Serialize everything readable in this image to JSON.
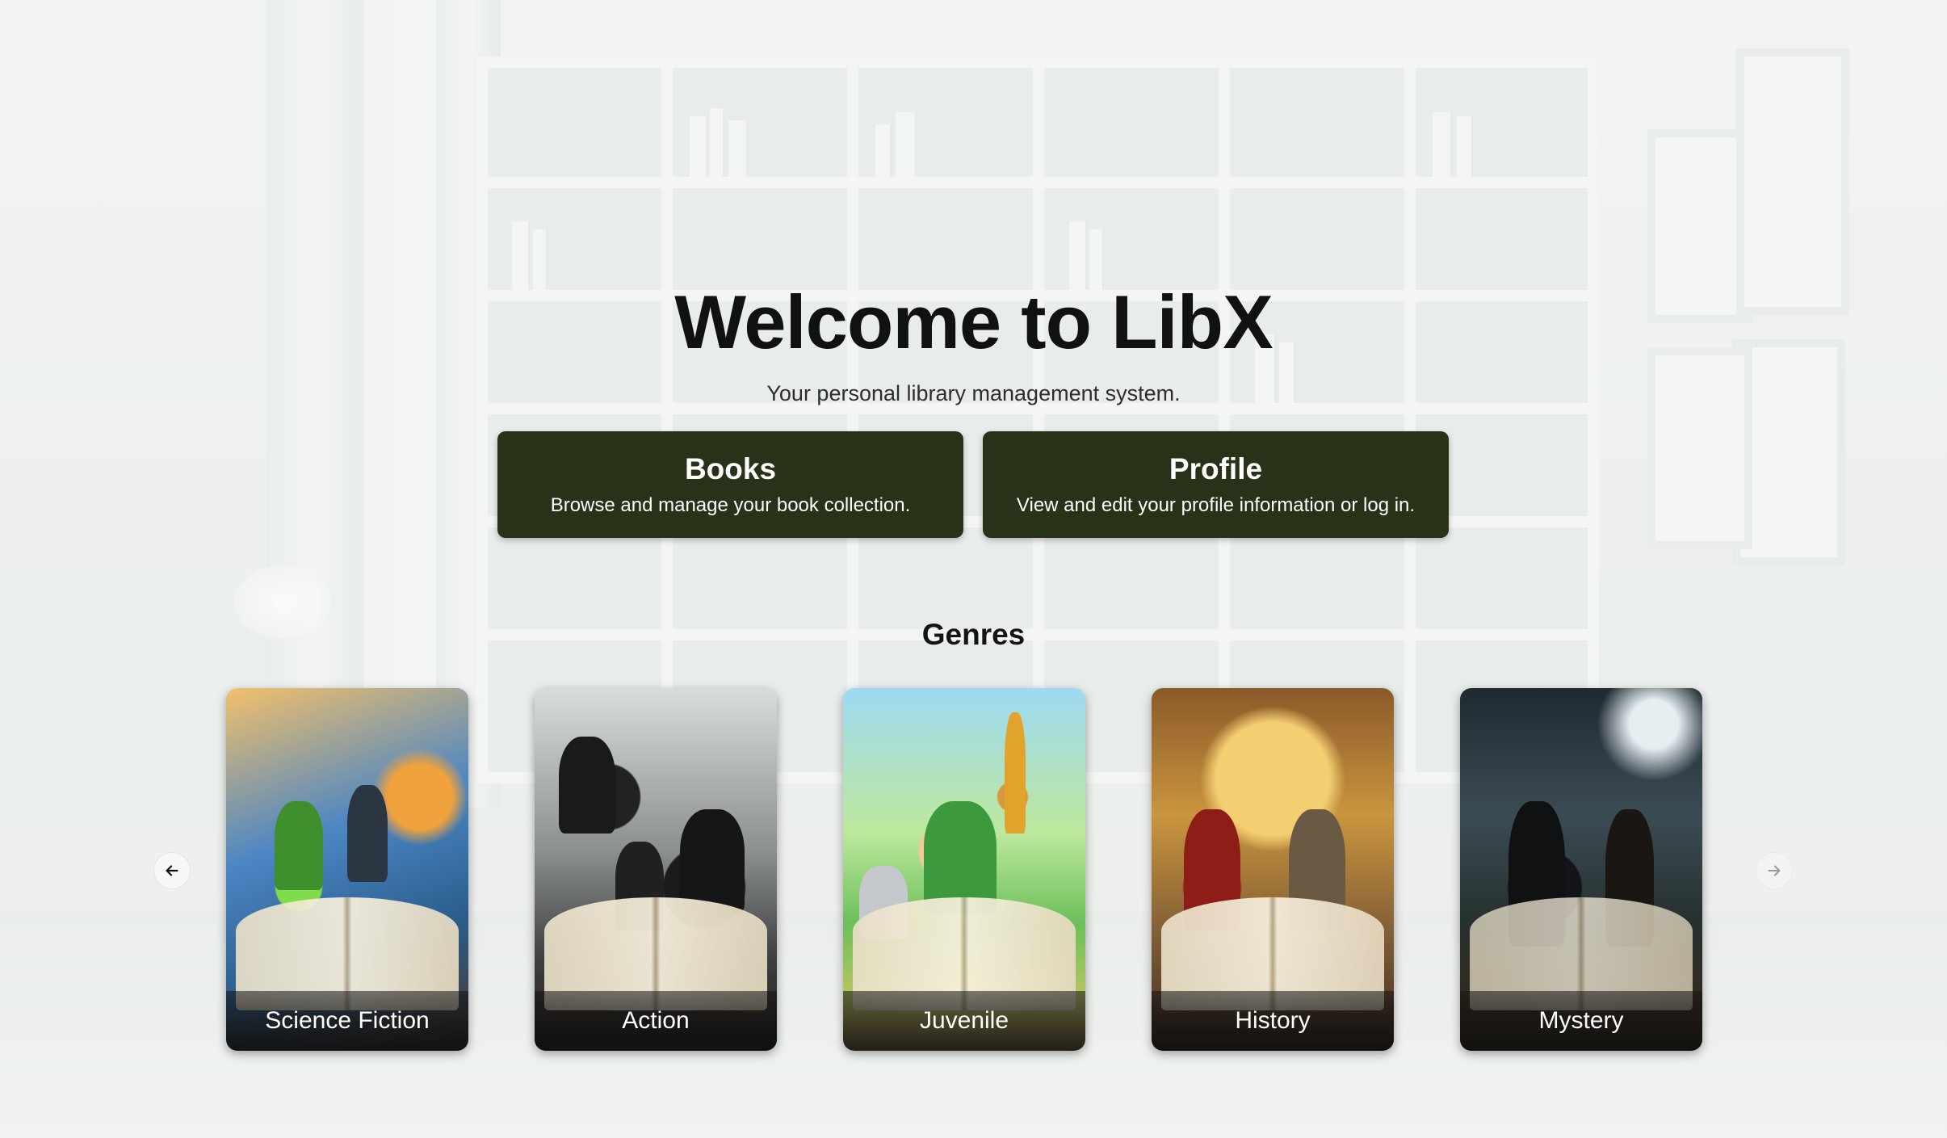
{
  "hero": {
    "title": "Welcome to LibX",
    "subtitle": "Your personal library management system."
  },
  "nav_cards": [
    {
      "title": "Books",
      "description": "Browse and manage your book collection."
    },
    {
      "title": "Profile",
      "description": "View and edit your profile information or log in."
    }
  ],
  "genres": {
    "heading": "Genres",
    "items": [
      {
        "label": "Science Fiction"
      },
      {
        "label": "Action"
      },
      {
        "label": "Juvenile"
      },
      {
        "label": "History"
      },
      {
        "label": "Mystery"
      }
    ],
    "prev_icon": "arrow-left-icon",
    "next_icon": "arrow-right-icon"
  },
  "colors": {
    "nav_card_bg": "#283218",
    "title_text": "#111111"
  }
}
